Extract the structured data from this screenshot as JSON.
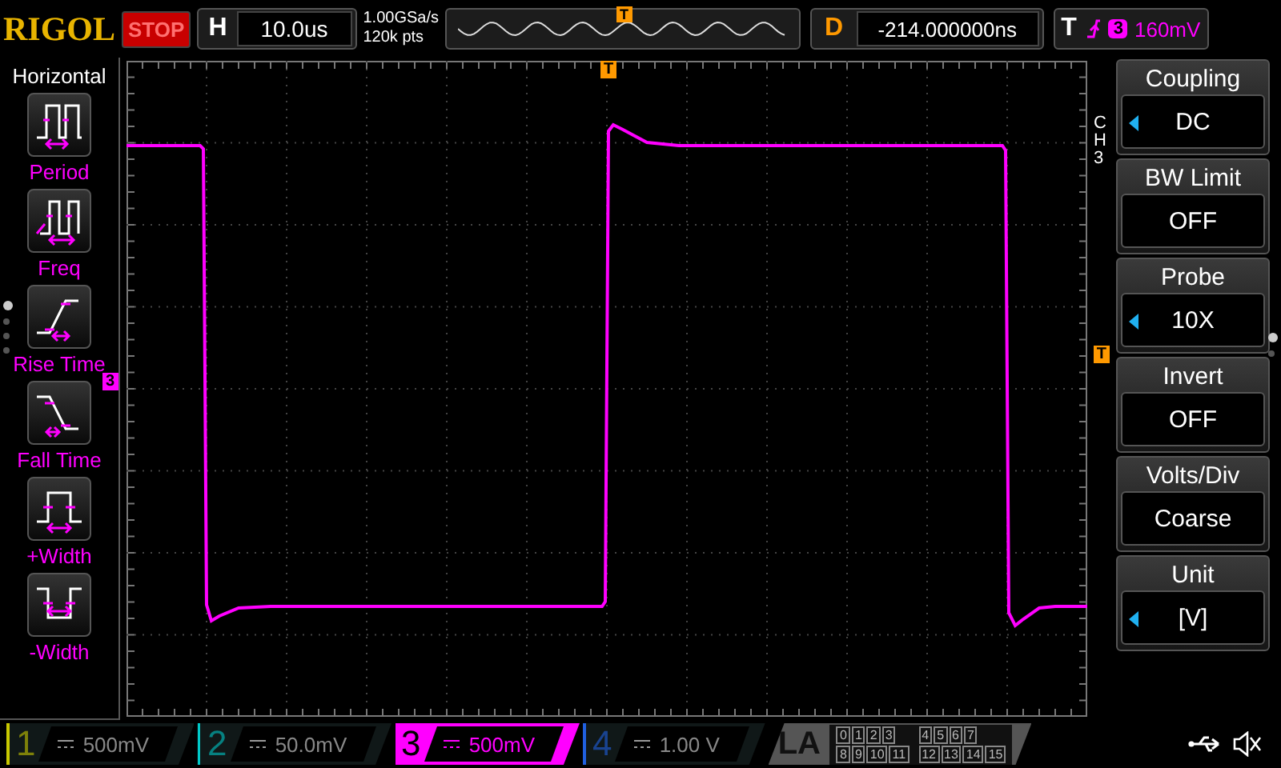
{
  "header": {
    "logo": "RIGOL",
    "run_state": "STOP",
    "timebase": {
      "label": "H",
      "value": "10.0us"
    },
    "sample_rate": "1.00GSa/s",
    "memory_depth": "120k pts",
    "overview_marker": "T",
    "delay": {
      "label": "D",
      "value": "-214.000000ns"
    },
    "trigger": {
      "label": "T",
      "source": "3",
      "level": "160mV"
    }
  },
  "measure_menu": {
    "title": "Horizontal",
    "items": [
      {
        "kind": "period",
        "label": "Period"
      },
      {
        "kind": "freq",
        "label": "Freq"
      },
      {
        "kind": "rise",
        "label": "Rise Time"
      },
      {
        "kind": "fall",
        "label": "Fall Time"
      },
      {
        "kind": "pwidth",
        "label": "+Width"
      },
      {
        "kind": "nwidth",
        "label": "-Width"
      }
    ],
    "pages": [
      {
        "selected": true
      },
      {
        "selected": false
      },
      {
        "selected": false
      },
      {
        "selected": false
      }
    ]
  },
  "scope": {
    "trigger_position_marker": "T",
    "channel_marker": "3",
    "trigger_level_marker": "T"
  },
  "channel_menu": {
    "side_label": "CH3",
    "items": [
      {
        "title": "Coupling",
        "value": "DC",
        "adjustable": true
      },
      {
        "title": "BW Limit",
        "value": "OFF",
        "adjustable": false
      },
      {
        "title": "Probe",
        "value": "10X",
        "adjustable": true
      },
      {
        "title": "Invert",
        "value": "OFF",
        "adjustable": false
      },
      {
        "title": "Volts/Div",
        "value": "Coarse",
        "adjustable": false
      },
      {
        "title": "Unit",
        "value": "[V]",
        "adjustable": true
      }
    ],
    "pages": [
      {
        "selected": true
      },
      {
        "selected": false
      }
    ]
  },
  "channels": [
    {
      "number": "1",
      "scale": "500mV",
      "color": "#c8c800",
      "selected": false
    },
    {
      "number": "2",
      "scale": "50.0mV",
      "color": "#00c8c8",
      "selected": false
    },
    {
      "number": "3",
      "scale": "500mV",
      "color": "#ff00ff",
      "selected": true
    },
    {
      "number": "4",
      "scale": "1.00 V",
      "color": "#2060e0",
      "selected": false
    }
  ],
  "logic_analyzer": {
    "label": "LA",
    "bits": [
      [
        "0",
        "1",
        "2",
        "3"
      ],
      [
        "4",
        "5",
        "6",
        "7"
      ],
      [
        "8",
        "9",
        "10",
        "11"
      ],
      [
        "12",
        "13",
        "14",
        "15"
      ]
    ]
  }
}
